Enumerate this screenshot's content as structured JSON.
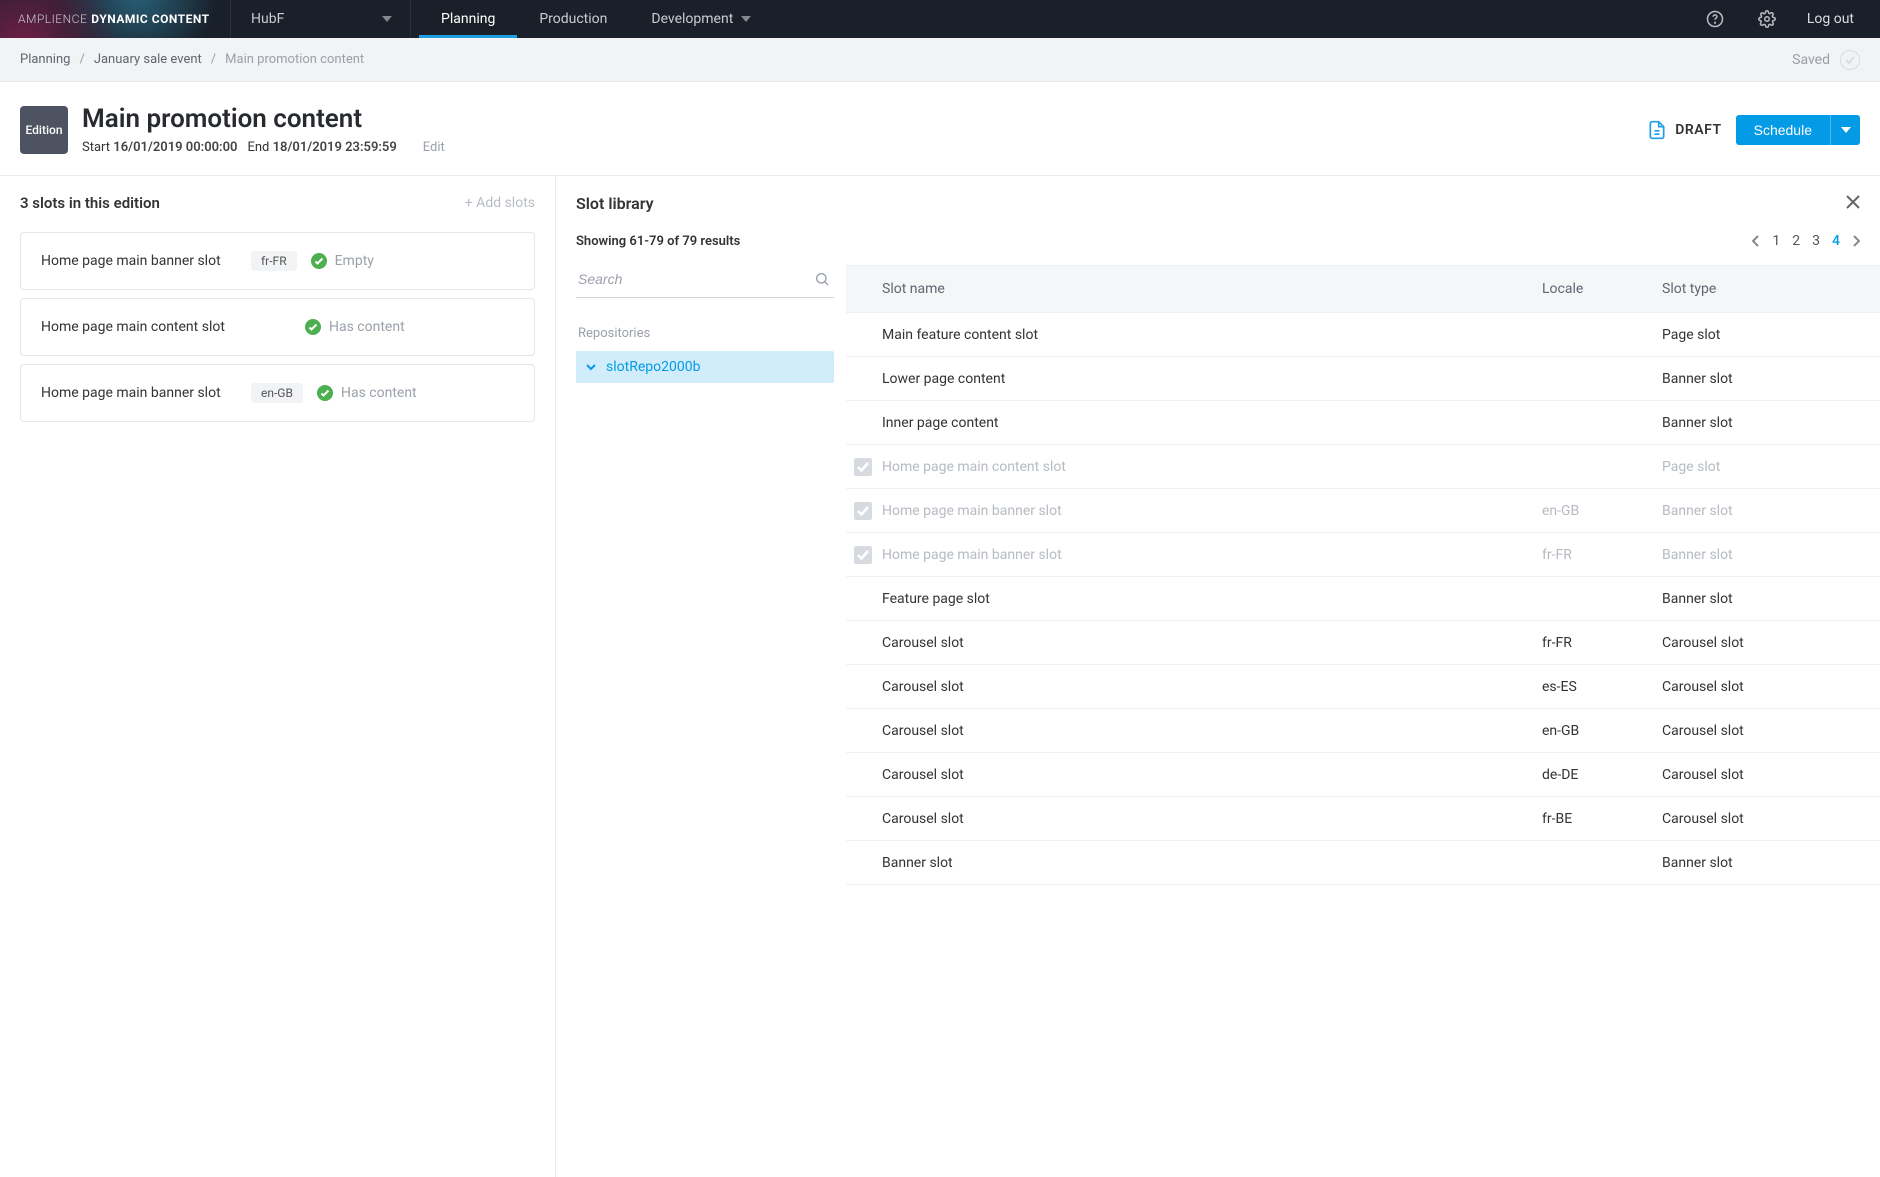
{
  "brand": {
    "light": "AMPLIENCE",
    "bold": "DYNAMIC CONTENT"
  },
  "hub": {
    "name": "HubF"
  },
  "nav": {
    "planning": "Planning",
    "production": "Production",
    "development": "Development"
  },
  "topright": {
    "logout": "Log out"
  },
  "breadcrumb": {
    "planning": "Planning",
    "event": "January sale event",
    "current": "Main promotion content",
    "saved": "Saved"
  },
  "edition": {
    "badge": "Edition",
    "title": "Main promotion content",
    "start_label": "Start",
    "start_value": "16/01/2019 00:00:00",
    "end_label": "End",
    "end_value": "18/01/2019 23:59:59",
    "edit": "Edit",
    "status": "DRAFT",
    "schedule": "Schedule"
  },
  "left": {
    "heading": "3 slots in this edition",
    "add": "+ Add slots",
    "slots": [
      {
        "name": "Home page main banner slot",
        "locale": "fr-FR",
        "status": "Empty"
      },
      {
        "name": "Home page main content slot",
        "locale": "",
        "status": "Has content"
      },
      {
        "name": "Home page main banner slot",
        "locale": "en-GB",
        "status": "Has content"
      }
    ]
  },
  "library": {
    "title": "Slot library",
    "results_text": "Showing 61-79 of 79 results",
    "pages": [
      "1",
      "2",
      "3",
      "4"
    ],
    "active_page_index": 3,
    "search_placeholder": "Search",
    "repos_label": "Repositories",
    "repo_name": "slotRepo2000b",
    "columns": {
      "name": "Slot name",
      "locale": "Locale",
      "type": "Slot type"
    },
    "rows": [
      {
        "name": "Main feature content slot",
        "locale": "",
        "type": "Page slot",
        "disabled": false,
        "checked": false
      },
      {
        "name": "Lower page content",
        "locale": "",
        "type": "Banner slot",
        "disabled": false,
        "checked": false
      },
      {
        "name": "Inner page content",
        "locale": "",
        "type": "Banner slot",
        "disabled": false,
        "checked": false
      },
      {
        "name": "Home page main content slot",
        "locale": "",
        "type": "Page slot",
        "disabled": true,
        "checked": true
      },
      {
        "name": "Home page main banner slot",
        "locale": "en-GB",
        "type": "Banner slot",
        "disabled": true,
        "checked": true
      },
      {
        "name": "Home page main banner slot",
        "locale": "fr-FR",
        "type": "Banner slot",
        "disabled": true,
        "checked": true
      },
      {
        "name": "Feature page slot",
        "locale": "",
        "type": "Banner slot",
        "disabled": false,
        "checked": false
      },
      {
        "name": "Carousel slot",
        "locale": "fr-FR",
        "type": "Carousel slot",
        "disabled": false,
        "checked": false
      },
      {
        "name": "Carousel slot",
        "locale": "es-ES",
        "type": "Carousel slot",
        "disabled": false,
        "checked": false
      },
      {
        "name": "Carousel slot",
        "locale": "en-GB",
        "type": "Carousel slot",
        "disabled": false,
        "checked": false
      },
      {
        "name": "Carousel slot",
        "locale": "de-DE",
        "type": "Carousel slot",
        "disabled": false,
        "checked": false
      },
      {
        "name": "Carousel slot",
        "locale": "fr-BE",
        "type": "Carousel slot",
        "disabled": false,
        "checked": false
      },
      {
        "name": "Banner slot",
        "locale": "",
        "type": "Banner slot",
        "disabled": false,
        "checked": false
      }
    ]
  }
}
